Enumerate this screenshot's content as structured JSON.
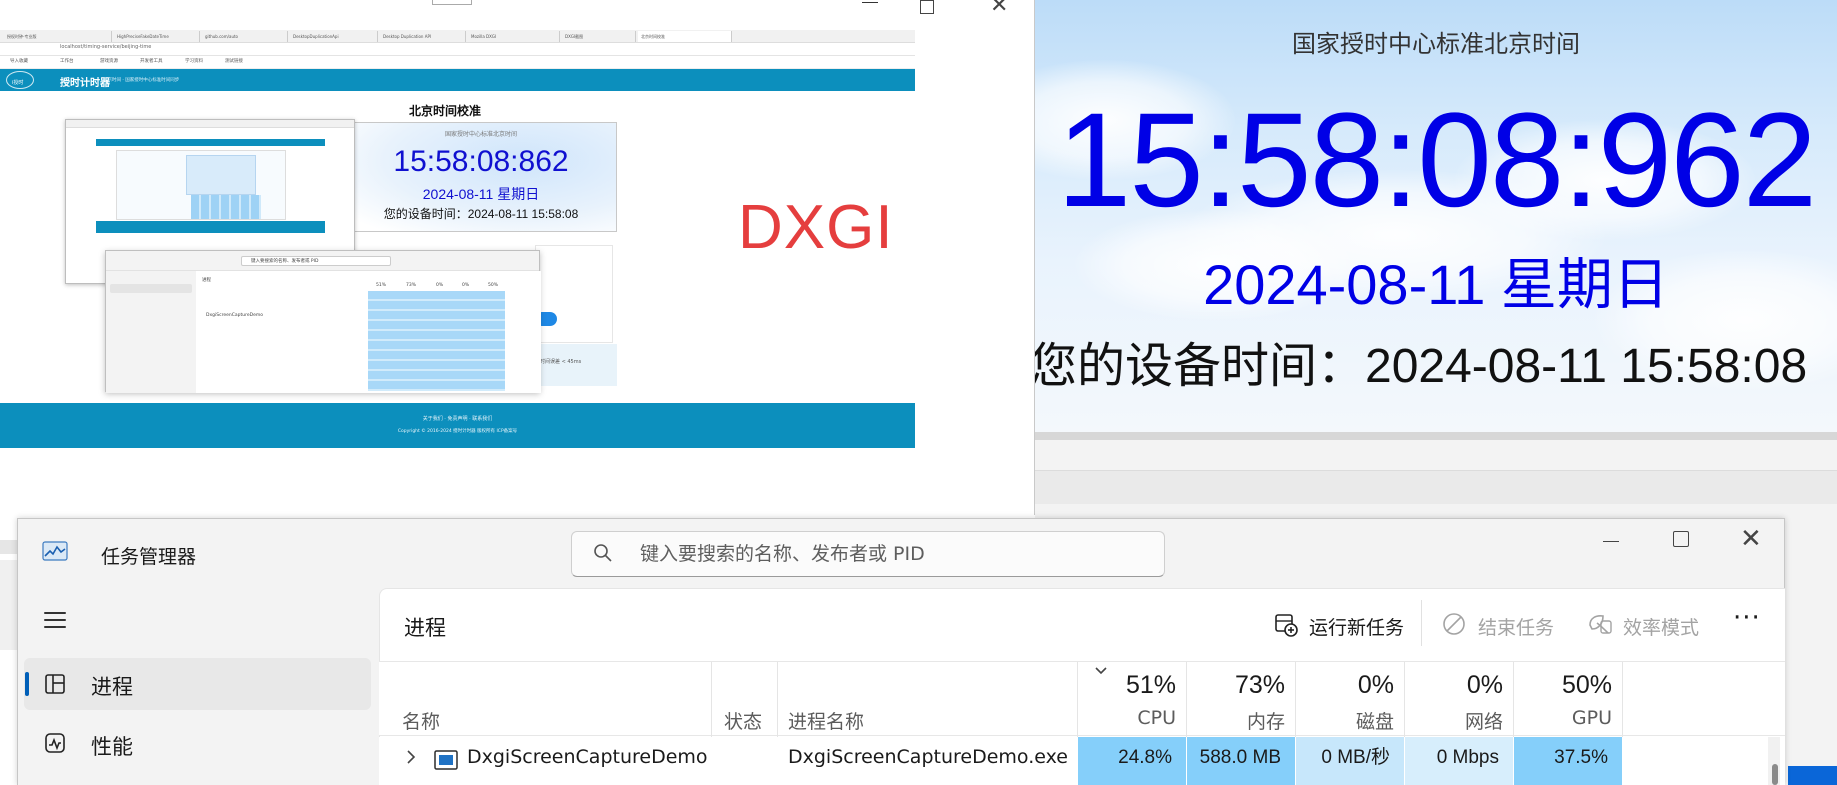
{
  "right_panel": {
    "heading": "国家授时中心标准北京时间",
    "clock": "15:58:08:962",
    "date": "2024-08-11 星期日",
    "device_time": "您的设备时间：2024-08-11 15:58:08"
  },
  "browser": {
    "tabs": [
      "授权时钟-专业版",
      "HighPreciseFakeDateTime",
      "github.com/auto",
      "DesktopDuplicationApi",
      "Desktop Duplication API",
      "Mozilla DXGI",
      "DXGI截图",
      "北京时间校准"
    ],
    "address_url": "localhost/timing-service/beijing-time",
    "bookmarks": [
      "导入收藏",
      "工作台",
      "游戏资源",
      "开发者工具",
      "学习资料",
      "测试链接"
    ],
    "site_logo_text": "i授时",
    "site_title": "授时计时器",
    "site_subtitle": "北京时间 · 国家授时中心标准时间同步",
    "page_heading": "北京时间校准",
    "box_caption": "国家授时中心标准北京时间",
    "small_clock": "15:58:08:862",
    "small_date": "2024-08-11 星期日",
    "small_device_time": "您的设备时间：2024-08-11 15:58:08",
    "section3_text": "时间误差 < 45ms",
    "footer_line1": "关于我们 · 免责声明 · 联系我们",
    "footer_line2": "Copyright © 2016-2024 授时计时器 版权所有 ICP备案号"
  },
  "overlay_label": "DXGI",
  "nested_preview": {
    "tm_search": "键入要搜索的名称、发布者或 PID",
    "tm_heading": "进程",
    "row1": "DxgiScreenCaptureDemo",
    "cols": [
      "51%",
      "73%",
      "0%",
      "0%",
      "50%"
    ]
  },
  "task_manager": {
    "title": "任务管理器",
    "search_placeholder": "键入要搜索的名称、发布者或 PID",
    "nav": {
      "processes": "进程",
      "performance": "性能"
    },
    "content_title": "进程",
    "toolbar": {
      "run_new_task": "运行新任务",
      "end_task": "结束任务",
      "efficiency_mode": "效率模式",
      "more": "···"
    },
    "columns": {
      "name": "名称",
      "status": "状态",
      "process_name": "进程名称",
      "cpu_pct": "51%",
      "cpu_label": "CPU",
      "mem_pct": "73%",
      "mem_label": "内存",
      "disk_pct": "0%",
      "disk_label": "磁盘",
      "net_pct": "0%",
      "net_label": "网络",
      "gpu_pct": "50%",
      "gpu_label": "GPU"
    },
    "rows": [
      {
        "name": "DxgiScreenCaptureDemo",
        "status": "",
        "process_name": "DxgiScreenCaptureDemo.exe",
        "cpu": "24.8%",
        "memory": "588.0 MB",
        "disk": "0 MB/秒",
        "network": "0 Mbps",
        "gpu": "37.5%"
      }
    ],
    "heat_colors": {
      "high": "#85cffa",
      "mid": "#c7e7fb",
      "light": "#d7eefc"
    }
  }
}
